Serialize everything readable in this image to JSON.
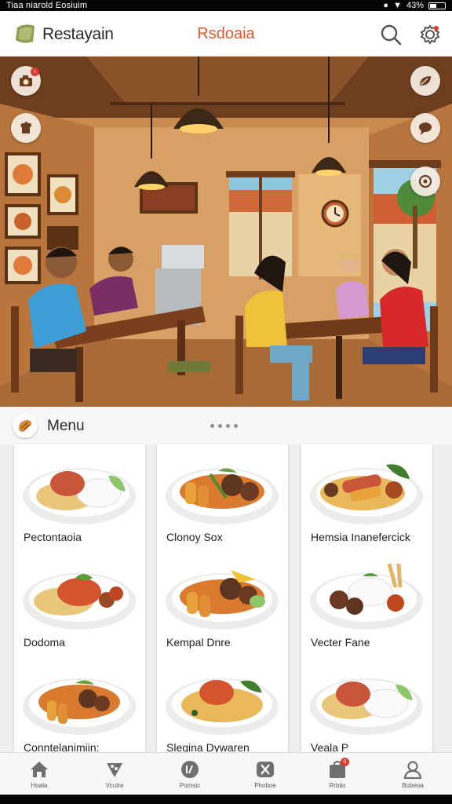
{
  "status_bar": {
    "left_text": "Tiaa niarold Eosiuim",
    "battery": "43%"
  },
  "header": {
    "brand": "Restayain",
    "center_title": "Rsdoaia"
  },
  "colors": {
    "accent": "#e2572a",
    "badge": "#e03a2c",
    "wall": "#c98a4f",
    "wood": "#6e3f1e"
  },
  "hero": {
    "buttons_left": [
      {
        "icon": "camera-icon",
        "badge": "r"
      },
      {
        "icon": "chef-hat-icon"
      }
    ],
    "buttons_right": [
      {
        "icon": "leaf-icon"
      },
      {
        "icon": "chat-bubble-icon"
      },
      {
        "icon": "location-icon"
      }
    ]
  },
  "menu": {
    "title": "Menu",
    "items": [
      {
        "name": "Pectontaoia"
      },
      {
        "name": "Clonoy Sox"
      },
      {
        "name": "Hemsia Inanefercick"
      },
      {
        "name": "Dodoma"
      },
      {
        "name": "Kempal Dnre"
      },
      {
        "name": "Vecter Fane"
      },
      {
        "name": "Conntelanimiin:"
      },
      {
        "name": "Slegina Dywaren"
      },
      {
        "name": "Veala P"
      }
    ]
  },
  "bottom_nav": [
    {
      "label": "Hoala",
      "icon": "home-icon"
    },
    {
      "label": "Vcutre",
      "icon": "pizza-icon"
    },
    {
      "label": "Pomsic",
      "icon": "plate-icon"
    },
    {
      "label": "Phoboe",
      "icon": "utensils-icon"
    },
    {
      "label": "Rrbiio",
      "icon": "bag-icon",
      "badge": "0"
    },
    {
      "label": "Bobeoa",
      "icon": "profile-icon"
    }
  ]
}
